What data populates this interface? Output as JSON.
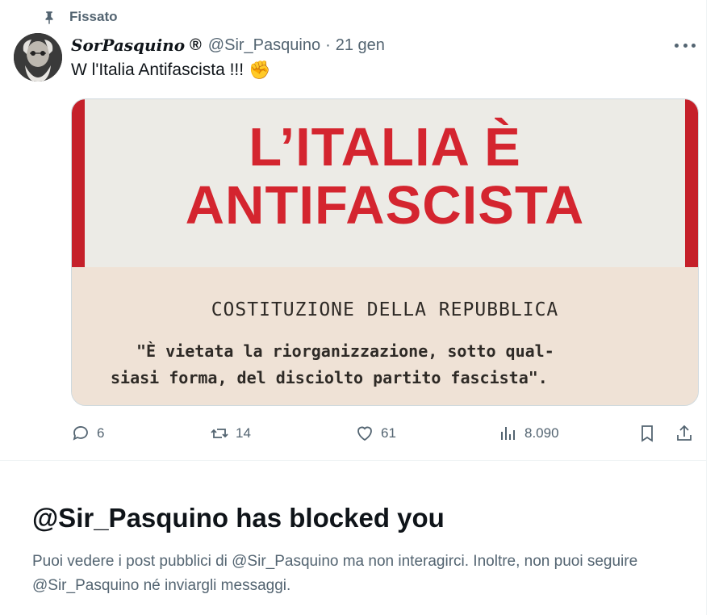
{
  "pinned": {
    "label": "Fissato",
    "icon": "pin-icon"
  },
  "tweet": {
    "author_name": "SorPasquino",
    "author_badge": "®",
    "handle": "@Sir_Pasquino",
    "separator": "·",
    "date": "21 gen",
    "text": "W l'Italia Antifascista !!!",
    "emoji": "✊",
    "media": {
      "headline_line1": "L’ITALIA È",
      "headline_line2": "ANTIFASCISTA",
      "subtitle": "COSTITUZIONE DELLA REPUBBLICA",
      "quote_line1": "\"È vietata la riorganizzazione, sotto qual-",
      "quote_line2": "siasi forma, del disciolto partito fascista\"."
    },
    "actions": {
      "replies": "6",
      "reposts": "14",
      "likes": "61",
      "views": "8.090"
    }
  },
  "blocked": {
    "title": "@Sir_Pasquino has blocked you",
    "description": "Puoi vedere i post pubblici di @Sir_Pasquino ma non interagirci. Inoltre, non puoi seguire @Sir_Pasquino né inviargli messaggi."
  },
  "colors": {
    "text_primary": "#0f1419",
    "text_secondary": "#536471",
    "poster_red": "#d4252f"
  }
}
